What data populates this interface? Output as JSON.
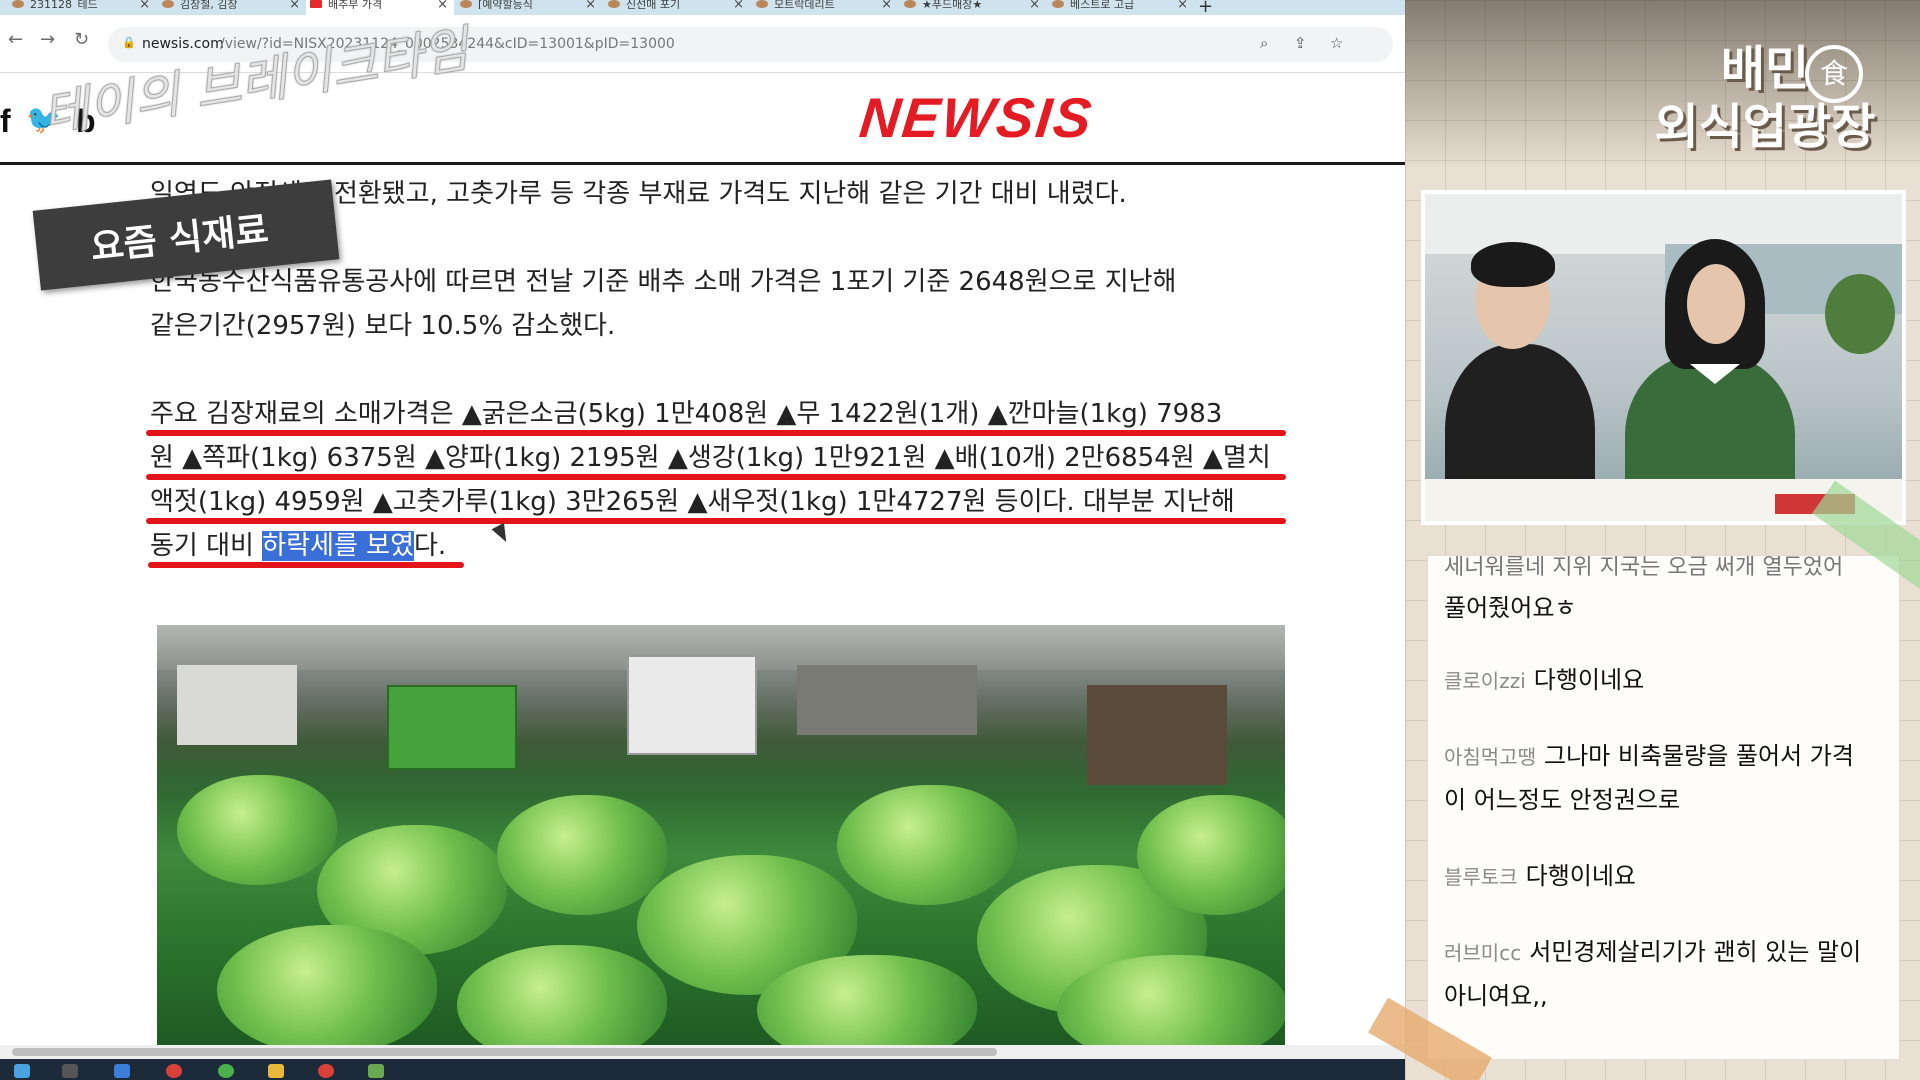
{
  "browser": {
    "tabs": [
      {
        "title": "231128_테드"
      },
      {
        "title": "김장철, 김장"
      },
      {
        "title": "배추부 가격"
      },
      {
        "title": "[예약할등식"
      },
      {
        "title": "신선매 포기"
      },
      {
        "title": "모트락데리트"
      },
      {
        "title": "★푸드매장★"
      },
      {
        "title": "베스트로 고급"
      }
    ],
    "active_tab_index": 2,
    "new_tab_label": "+",
    "url_host": "newsis.com",
    "url_path": "/view/?id=NISX20231124_0002534244&cID=13001&pID=13000"
  },
  "site": {
    "logo": "NEWSIS",
    "social": [
      "f",
      "🐦",
      "b"
    ]
  },
  "article": {
    "p1": "일영도 안정세로 전환됐고, 고춧가루 등 각종 부재료 가격도 지난해 같은 기간 대비 내렸다.",
    "p2_line1": "한국농수산식품유통공사에 따르면 전날 기준 배추 소매 가격은 1포기 기준 2648원으로 지난해",
    "p2_line2": "같은기간(2957원) 보다 10.5% 감소했다.",
    "p3_line1": "주요 김장재료의 소매가격은 ▲굵은소금(5kg) 1만408원 ▲무 1422원(1개) ▲깐마늘(1kg) 7983",
    "p3_line2": "원 ▲쪽파(1kg) 6375원 ▲양파(1kg) 2195원 ▲생강(1kg) 1만921원 ▲배(10개) 2만6854원 ▲멸치",
    "p3_line3": "액젓(1kg) 4959원 ▲고춧가루(1kg) 3만265원 ▲새우젓(1kg) 1만4727원 등이다. 대부분 지난해",
    "p3_line4_pre": "동기 대비 ",
    "p3_line4_highlight": "하락세를 보였",
    "p3_line4_post": "다."
  },
  "overlay": {
    "show_title": "테이의 브레이크타임",
    "sticker": "요즘 식재료"
  },
  "panel": {
    "brand_line1": "배민",
    "brand_line2": "외식업광장",
    "brand_icon": "食",
    "chat": [
      {
        "user": "",
        "text": "세너워를네 지위 지국는 오금 써개 열두었어"
      },
      {
        "user": "",
        "text": "풀어줬어요ㅎ"
      },
      {
        "user": "클로이zzi",
        "text": "다행이네요"
      },
      {
        "user": "아침먹고땡",
        "text": "그나마 비축물량을 풀어서 가격"
      },
      {
        "user": "",
        "text": "이 어느정도 안정권으로"
      },
      {
        "user": "블루토크",
        "text": "다행이네요"
      },
      {
        "user": "러브미cc",
        "text": "서민경제살리기가 괜히 있는 말이"
      },
      {
        "user": "",
        "text": "아니여요,,"
      }
    ]
  },
  "colors": {
    "newsis_red": "#e41b23",
    "underline_red": "#e3141a",
    "selection_blue": "#3b6fd8"
  }
}
